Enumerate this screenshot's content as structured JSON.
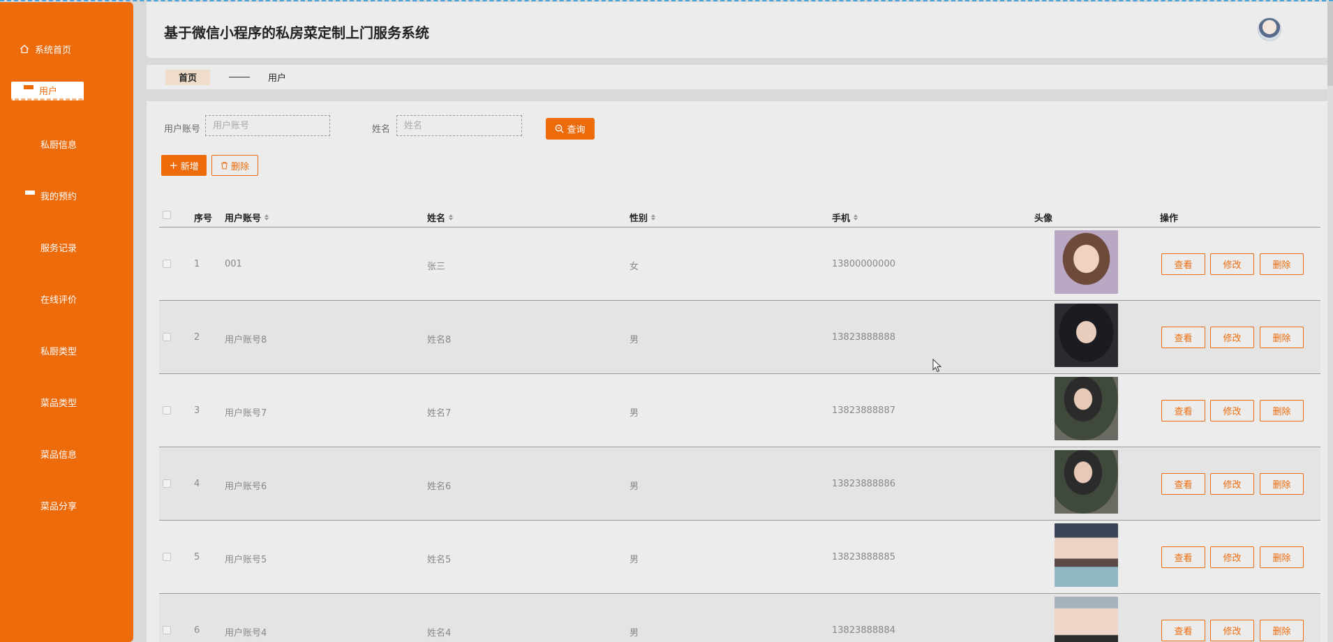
{
  "header": {
    "title": "基于微信小程序的私房菜定制上门服务系统"
  },
  "sidebar": {
    "items": [
      {
        "label": "系统首页",
        "icon": "home-icon"
      },
      {
        "label": "用户",
        "icon": "list-icon",
        "active": true
      },
      {
        "label": "私厨信息",
        "icon": "grid-icon"
      },
      {
        "label": "我的预约",
        "icon": "list-icon"
      },
      {
        "label": "服务记录",
        "icon": "grid-icon"
      },
      {
        "label": "在线评价",
        "icon": "grid-icon"
      },
      {
        "label": "私厨类型",
        "icon": "grid-icon"
      },
      {
        "label": "菜品类型",
        "icon": "grid-icon"
      },
      {
        "label": "菜品信息",
        "icon": "grid-icon"
      },
      {
        "label": "菜品分享",
        "icon": "monitor-icon"
      }
    ]
  },
  "breadcrumb": {
    "home": "首页",
    "current": "用户"
  },
  "search": {
    "account_label": "用户账号",
    "account_placeholder": "用户账号",
    "name_label": "姓名",
    "name_placeholder": "姓名",
    "query_label": "查询"
  },
  "toolbar": {
    "add_label": "新增",
    "delete_label": "删除"
  },
  "table": {
    "headers": {
      "index": "序号",
      "account": "用户账号",
      "name": "姓名",
      "gender": "性别",
      "phone": "手机",
      "avatar": "头像",
      "actions": "操作"
    },
    "actions": {
      "view": "查看",
      "edit": "修改",
      "delete": "删除"
    },
    "rows": [
      {
        "index": "1",
        "account": "001",
        "name": "张三",
        "gender": "女",
        "phone": "13800000000"
      },
      {
        "index": "2",
        "account": "用户账号8",
        "name": "姓名8",
        "gender": "男",
        "phone": "13823888888"
      },
      {
        "index": "3",
        "account": "用户账号7",
        "name": "姓名7",
        "gender": "男",
        "phone": "13823888887"
      },
      {
        "index": "4",
        "account": "用户账号6",
        "name": "姓名6",
        "gender": "男",
        "phone": "13823888886"
      },
      {
        "index": "5",
        "account": "用户账号5",
        "name": "姓名5",
        "gender": "男",
        "phone": "13823888885"
      },
      {
        "index": "6",
        "account": "用户账号4",
        "name": "姓名4",
        "gender": "男",
        "phone": "13823888884"
      }
    ]
  },
  "colors": {
    "accent": "#ee6b0c",
    "sidebar": "#ee6b0c",
    "panel": "#ececec"
  }
}
